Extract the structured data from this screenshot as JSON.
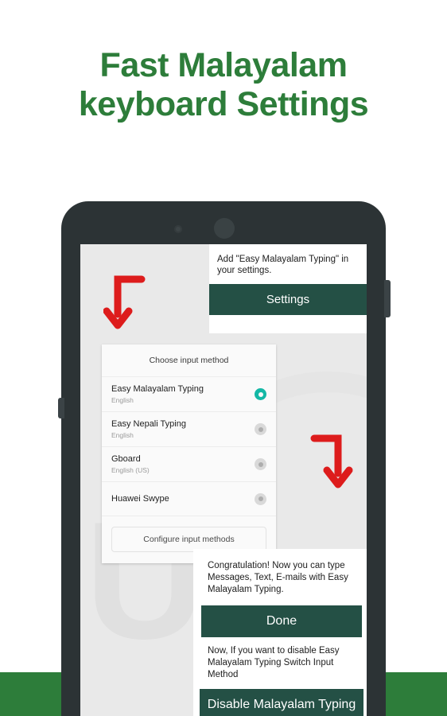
{
  "page": {
    "headline_line1": "Fast Malayalam",
    "headline_line2": "keyboard Settings",
    "headline_color": "#2d7d3a",
    "background_color": "#ffffff",
    "bottom_band_color": "#2d7d3a"
  },
  "device": {
    "frame_color": "#2c3335",
    "screen_background": "#e9e9e9",
    "watermark_letter": "U"
  },
  "annotations": {
    "arrow_color": "#dd1c1c",
    "arrow_1_label": "arrow pointing to Settings button",
    "arrow_2_label": "arrow pointing to Done dialog"
  },
  "settings_card": {
    "message": "Add \"Easy Malayalam Typing\" in your settings.",
    "button_label": "Settings",
    "button_color": "#245045"
  },
  "input_method_dialog": {
    "title": "Choose input method",
    "selected_color": "#14b8a6",
    "methods": [
      {
        "name": "Easy Malayalam Typing",
        "subtitle": "English",
        "selected": true
      },
      {
        "name": "Easy Nepali Typing",
        "subtitle": "English",
        "selected": false
      },
      {
        "name": "Gboard",
        "subtitle": "English (US)",
        "selected": false
      },
      {
        "name": "Huawei Swype",
        "subtitle": "",
        "selected": false
      }
    ],
    "configure_label": "Configure input methods"
  },
  "done_card": {
    "message": "Congratulation! Now you can type Messages, Text, E-mails with Easy Malayalam Typing.",
    "done_label": "Done",
    "note": "Now, If you want to disable Easy Malayalam Typing Switch Input Method",
    "disable_label": "Disable Malayalam Typing",
    "button_color": "#245045"
  }
}
